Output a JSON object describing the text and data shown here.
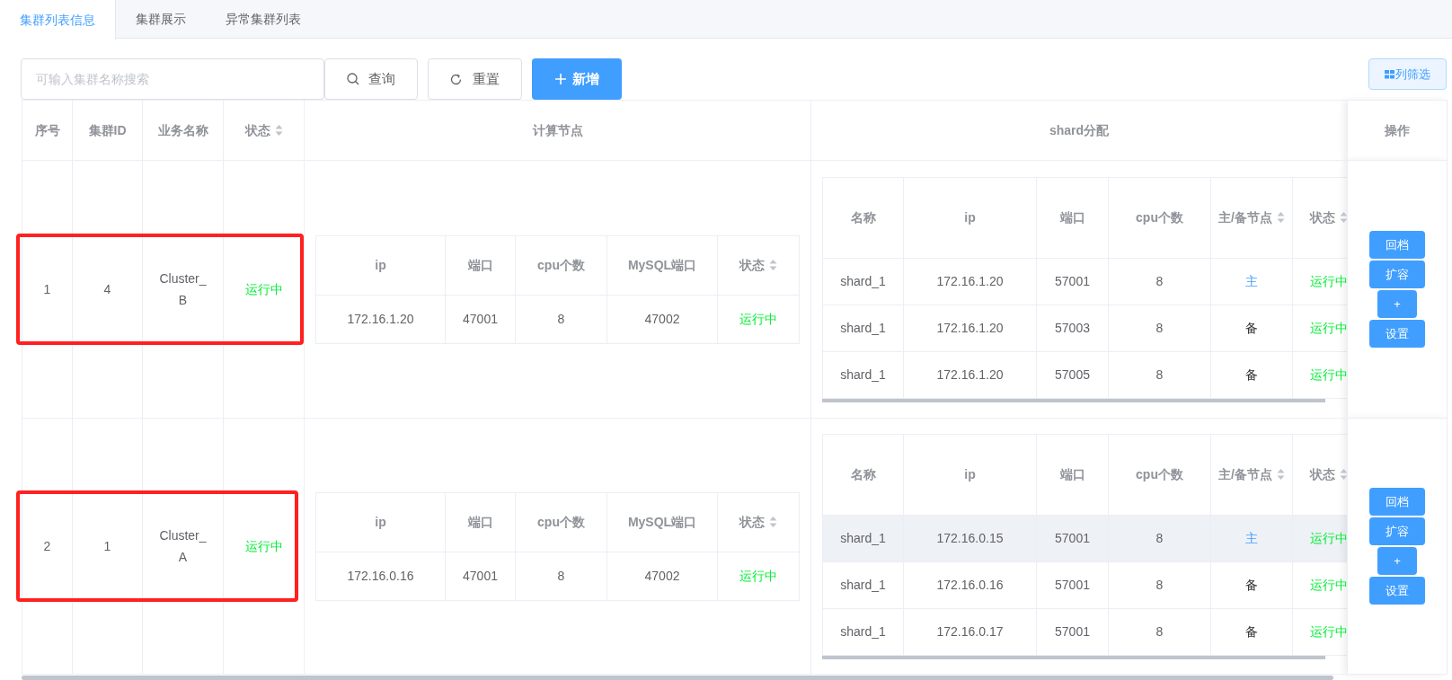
{
  "tabs": [
    {
      "label": "集群列表信息",
      "selected": true
    },
    {
      "label": "集群展示",
      "selected": false
    },
    {
      "label": "异常集群列表",
      "selected": false
    }
  ],
  "search": {
    "placeholder": "可输入集群名称搜索"
  },
  "buttons": [
    {
      "kind": "search",
      "label": "查询"
    },
    {
      "kind": "reset",
      "label": "重置"
    },
    {
      "kind": "add",
      "label": "新增"
    }
  ],
  "column_filter": {
    "label": "列筛选"
  },
  "table": {
    "columns": [
      {
        "label": "序号",
        "sortable": false
      },
      {
        "label": "集群ID",
        "sortable": false
      },
      {
        "label": "业务名称",
        "sortable": false
      },
      {
        "label": "状态",
        "sortable": true
      },
      {
        "label": "计算节点",
        "sortable": false
      },
      {
        "label": "shard分配",
        "sortable": false
      },
      {
        "label": "操作",
        "sortable": false
      }
    ],
    "rows": [
      {
        "index": "1",
        "id": "4",
        "name": "Cluster_B",
        "status": "运行中",
        "marked": true,
        "compute_columns": [
          {
            "label": "ip",
            "sortable": false
          },
          {
            "label": "端口",
            "sortable": false
          },
          {
            "label": "cpu个数",
            "sortable": false
          },
          {
            "label": "MySQL端口",
            "sortable": false
          },
          {
            "label": "状态",
            "sortable": true
          }
        ],
        "compute": [
          {
            "ip": "172.16.1.20",
            "port": "47001",
            "cpu": "8",
            "mysql_port": "47002",
            "status": "运行中"
          }
        ],
        "shard_columns": [
          {
            "label": "名称",
            "sortable": false
          },
          {
            "label": "ip",
            "sortable": false
          },
          {
            "label": "端口",
            "sortable": false
          },
          {
            "label": "cpu个数",
            "sortable": false
          },
          {
            "label": "主/备节点",
            "sortable": true
          },
          {
            "label": "状态",
            "sortable": true
          }
        ],
        "shards": [
          {
            "name": "shard_1",
            "ip": "172.16.1.20",
            "port": "57001",
            "cpu": "8",
            "role": "主",
            "primary": true,
            "hovered": false,
            "status": "运行中"
          },
          {
            "name": "shard_1",
            "ip": "172.16.1.20",
            "port": "57003",
            "cpu": "8",
            "role": "备",
            "primary": false,
            "hovered": false,
            "status": "运行中"
          },
          {
            "name": "shard_1",
            "ip": "172.16.1.20",
            "port": "57005",
            "cpu": "8",
            "role": "备",
            "primary": false,
            "hovered": false,
            "status": "运行中"
          }
        ],
        "actions": [
          {
            "kind": "wide",
            "label": "回档"
          },
          {
            "kind": "wide",
            "label": "扩容"
          },
          {
            "kind": "narrow",
            "label": "+"
          },
          {
            "kind": "wide",
            "label": "设置"
          }
        ]
      },
      {
        "index": "2",
        "id": "1",
        "name": "Cluster_A",
        "status": "运行中",
        "marked": true,
        "compute_columns": [
          {
            "label": "ip",
            "sortable": false
          },
          {
            "label": "端口",
            "sortable": false
          },
          {
            "label": "cpu个数",
            "sortable": false
          },
          {
            "label": "MySQL端口",
            "sortable": false
          },
          {
            "label": "状态",
            "sortable": true
          }
        ],
        "compute": [
          {
            "ip": "172.16.0.16",
            "port": "47001",
            "cpu": "8",
            "mysql_port": "47002",
            "status": "运行中"
          }
        ],
        "shard_columns": [
          {
            "label": "名称",
            "sortable": false
          },
          {
            "label": "ip",
            "sortable": false
          },
          {
            "label": "端口",
            "sortable": false
          },
          {
            "label": "cpu个数",
            "sortable": false
          },
          {
            "label": "主/备节点",
            "sortable": true
          },
          {
            "label": "状态",
            "sortable": true
          }
        ],
        "shards": [
          {
            "name": "shard_1",
            "ip": "172.16.0.15",
            "port": "57001",
            "cpu": "8",
            "role": "主",
            "primary": true,
            "hovered": true,
            "status": "运行中"
          },
          {
            "name": "shard_1",
            "ip": "172.16.0.16",
            "port": "57001",
            "cpu": "8",
            "role": "备",
            "primary": false,
            "hovered": false,
            "status": "运行中"
          },
          {
            "name": "shard_1",
            "ip": "172.16.0.17",
            "port": "57001",
            "cpu": "8",
            "role": "备",
            "primary": false,
            "hovered": false,
            "status": "运行中"
          }
        ],
        "actions": [
          {
            "kind": "wide",
            "label": "回档"
          },
          {
            "kind": "wide",
            "label": "扩容"
          },
          {
            "kind": "narrow",
            "label": "+"
          },
          {
            "kind": "wide",
            "label": "设置"
          }
        ]
      }
    ]
  }
}
